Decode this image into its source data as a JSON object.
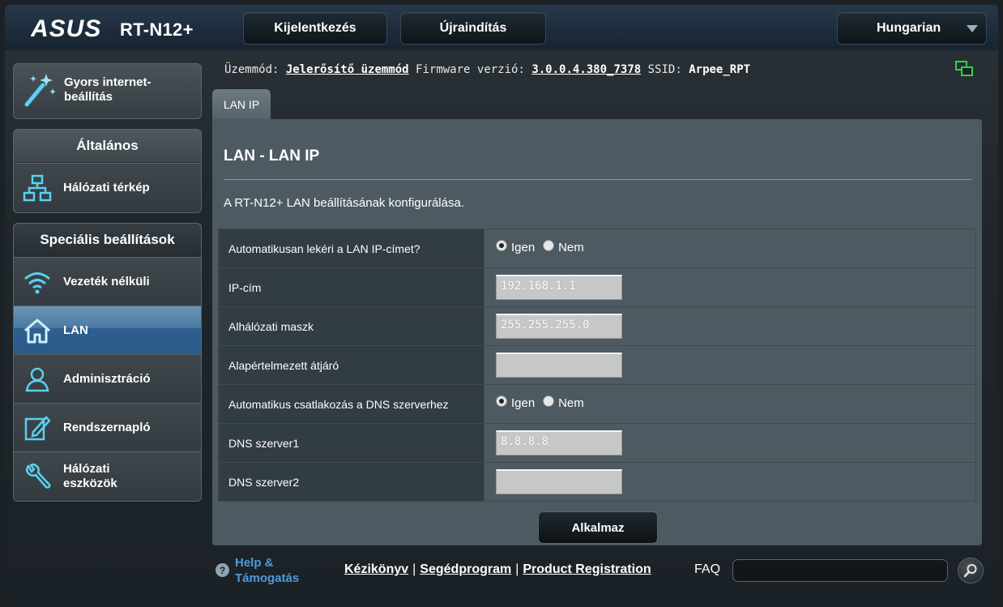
{
  "header": {
    "brand": "ASUS",
    "model": "RT-N12+",
    "logout_label": "Kijelentkezés",
    "reboot_label": "Újraindítás",
    "language": "Hungarian"
  },
  "sidebar": {
    "quick_setup": "Gyors internet-beállítás",
    "general_title": "Általános",
    "general_items": [
      {
        "label": "Hálózati térkép",
        "icon": "network-map-icon"
      }
    ],
    "advanced_title": "Speciális beállítások",
    "advanced_items": [
      {
        "label": "Vezeték nélküli",
        "icon": "wifi-icon"
      },
      {
        "label": "LAN",
        "icon": "home-icon",
        "active": true
      },
      {
        "label": "Adminisztráció",
        "icon": "user-icon"
      },
      {
        "label": "Rendszernapló",
        "icon": "log-edit-icon"
      },
      {
        "label": "Hálózati eszközök",
        "icon": "wrench-icon"
      }
    ]
  },
  "status": {
    "mode_label": "Üzemmód:",
    "mode_value": "Jelerősítő üzemmód",
    "firmware_label": "Firmware verzió:",
    "firmware_value": "3.0.0.4.380_7378",
    "ssid_label": "SSID:",
    "ssid_value": "Arpee_RPT"
  },
  "main": {
    "tab": "LAN IP",
    "title": "LAN - LAN IP",
    "description": "A RT-N12+ LAN beállításának konfigurálása.",
    "rows": [
      {
        "label": "Automatikusan lekéri a LAN IP-címet?",
        "type": "radio",
        "options": [
          "Igen",
          "Nem"
        ],
        "selected": "Igen"
      },
      {
        "label": "IP-cím",
        "type": "input",
        "value": "192.168.1.1"
      },
      {
        "label": "Alhálózati maszk",
        "type": "input",
        "value": "255.255.255.0"
      },
      {
        "label": "Alapértelmezett átjáró",
        "type": "input",
        "value": ""
      },
      {
        "label": "Automatikus csatlakozás a DNS szerverhez",
        "type": "radio",
        "options": [
          "Igen",
          "Nem"
        ],
        "selected": "Igen"
      },
      {
        "label": "DNS szerver1",
        "type": "input",
        "value": "8.8.8.8"
      },
      {
        "label": "DNS szerver2",
        "type": "input",
        "value": ""
      }
    ],
    "apply_label": "Alkalmaz"
  },
  "footer": {
    "help_label": "Help & Támogatás",
    "links": [
      "Kézikönyv",
      "Segédprogram",
      "Product Registration"
    ],
    "faq_label": "FAQ"
  },
  "colors": {
    "accent_blue": "#4f9be0",
    "active_nav": "#2e5f8f",
    "icon_cyan": "#5ad0f0",
    "status_green": "#2fd14a"
  }
}
